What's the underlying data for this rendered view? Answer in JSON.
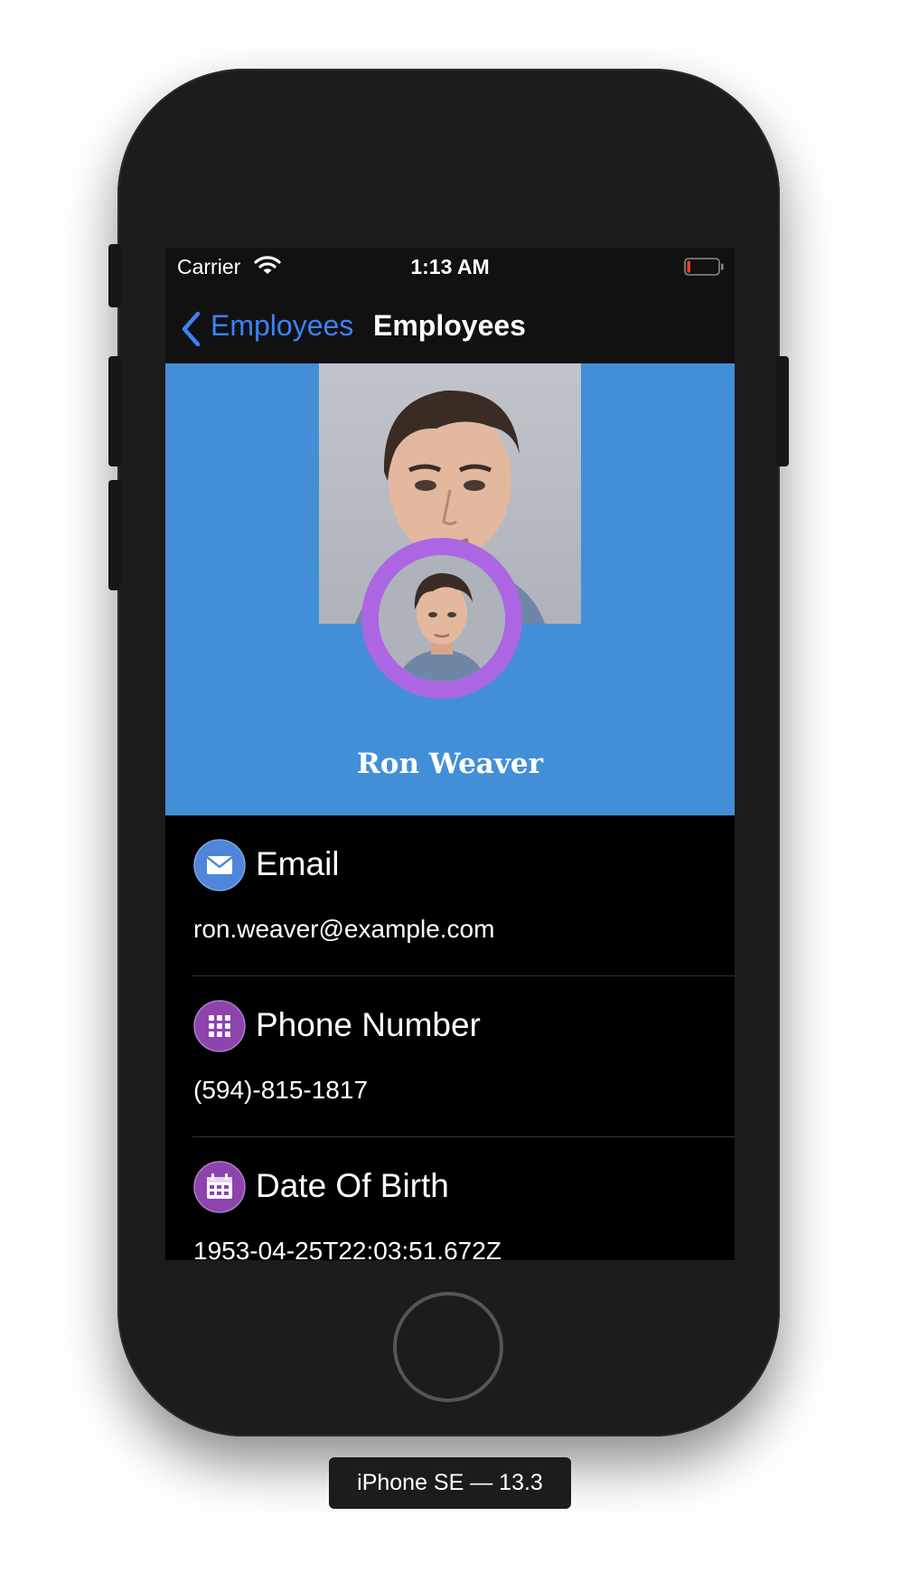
{
  "status_bar": {
    "carrier": "Carrier",
    "time": "1:13 AM",
    "wifi_icon": "wifi-icon",
    "battery_icon": "battery-icon",
    "battery_level": 0.08
  },
  "nav": {
    "back_label": "Employees",
    "title": "Employees",
    "back_icon": "chevron-left-icon"
  },
  "profile": {
    "name": "Ron Weaver",
    "hero_photo": "portrait-photo",
    "avatar": "avatar-photo"
  },
  "details": [
    {
      "label": "Email",
      "value": "ron.weaver@example.com",
      "icon": "email-icon"
    },
    {
      "label": "Phone Number",
      "value": "(594)-815-1817",
      "icon": "keypad-icon"
    },
    {
      "label": "Date Of Birth",
      "value": "1953-04-25T22:03:51.672Z",
      "icon": "calendar-icon"
    }
  ],
  "device_label": "iPhone SE — 13.3",
  "colors": {
    "accent_blue": "#3b82f6",
    "header_blue": "#428fd8",
    "avatar_ring": "#ad66e3",
    "email_icon": "#4f86d9",
    "phone_icon": "#8e44ad",
    "calendar_icon": "#8e44ad"
  }
}
